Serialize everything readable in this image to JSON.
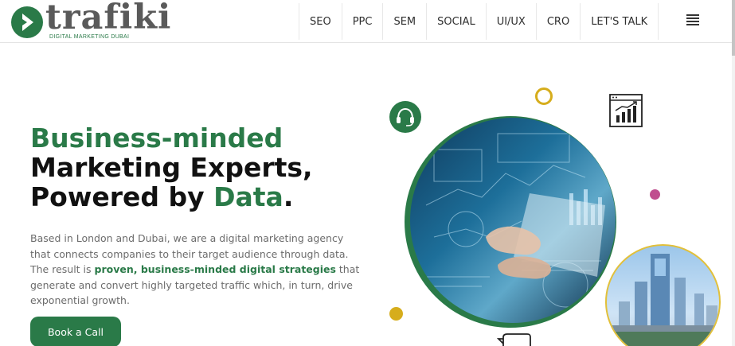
{
  "brand": {
    "name": "trafiki",
    "tagline": "DIGITAL MARKETING DUBAI",
    "colors": {
      "primary_green": "#2a7a48",
      "accent_yellow": "#d6ad1c",
      "accent_pink": "#c04e8f",
      "logo_gray": "#5a5a5a"
    }
  },
  "nav": {
    "items": [
      {
        "label": "SEO"
      },
      {
        "label": "PPC"
      },
      {
        "label": "SEM"
      },
      {
        "label": "SOCIAL"
      },
      {
        "label": "UI/UX"
      },
      {
        "label": "CRO"
      },
      {
        "label": "LET'S TALK"
      }
    ],
    "menu_icon": "hamburger-icon"
  },
  "hero": {
    "title_line1": "Business-minded",
    "title_line2": "Marketing Experts,",
    "title_line3_a": "Powered by ",
    "title_line3_b": "Data",
    "title_line3_c": ".",
    "description_a": "Based in London and Dubai, we are a digital marketing agency that connects companies to their target audience through data. The result is ",
    "description_strong": "proven, business-minded digital strategies",
    "description_b": " that generate and convert highly targeted traffic which, in turn, drive exponential growth.",
    "cta_label": "Book a Call"
  },
  "illustration": {
    "icons": [
      "headset-icon",
      "analytics-chart-icon",
      "chat-bubble-icon"
    ],
    "images": [
      "hands-on-laptop-data-image",
      "dubai-city-image"
    ]
  }
}
